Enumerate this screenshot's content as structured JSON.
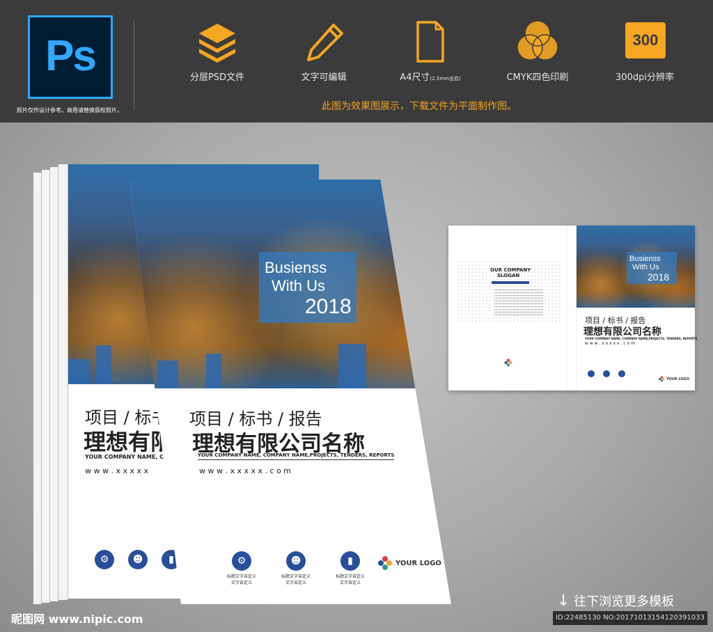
{
  "banner": {
    "ps_logo": "Ps",
    "ps_note": "照片仅作设计参考。商用请替换版权照片。",
    "features": [
      {
        "icon": "layers-icon",
        "label": "分层PSD文件"
      },
      {
        "icon": "pencil-icon",
        "label": "文字可编辑"
      },
      {
        "icon": "page-icon",
        "label": "A4尺寸",
        "sub": "(2.5mm出血)"
      },
      {
        "icon": "cmyk-circles-icon",
        "label": "CMYK四色印刷"
      },
      {
        "icon": "badge-300-icon",
        "badge": "300",
        "label": "300dpi分辨率"
      }
    ],
    "notice": "此图为效果图展示，下载文件为平面制作图。"
  },
  "cover": {
    "headline_1": "Busienss",
    "headline_2": "With Us",
    "year": "2018",
    "category": "项目 / 标书 / 报告",
    "company": "理想有限公司名称",
    "company_en": "YOUR COMPANY NAME, COMPANY NAME,PROJECTS, TENDERS, REPORTS",
    "website": "w w w . x x x x x . c o m",
    "icon_captions": [
      "标题文字自定义\n文字自定义",
      "标题文字自定义\n文字自定义",
      "标题文字自定义\n文字自定义"
    ],
    "logo": "YOUR LOGO"
  },
  "back_cover": {
    "company_label": "OUR COMPANY",
    "slogan": "SLOGAN"
  },
  "back_stack": {
    "category": "项目 / 标书",
    "company": "理想有限",
    "company_en": "YOUR COMPANY NAME, COMPANY N",
    "website": "w w w . x x x x x"
  },
  "footer": {
    "site": "昵图网 www.nipic.com",
    "browse": "往下浏览更多模板",
    "id_line": "ID:22485130 NO:20171013154120391033"
  },
  "colors": {
    "accent": "#f0a020",
    "ps_blue": "#31a8ff",
    "brand_blue": "#2a4f9a"
  }
}
